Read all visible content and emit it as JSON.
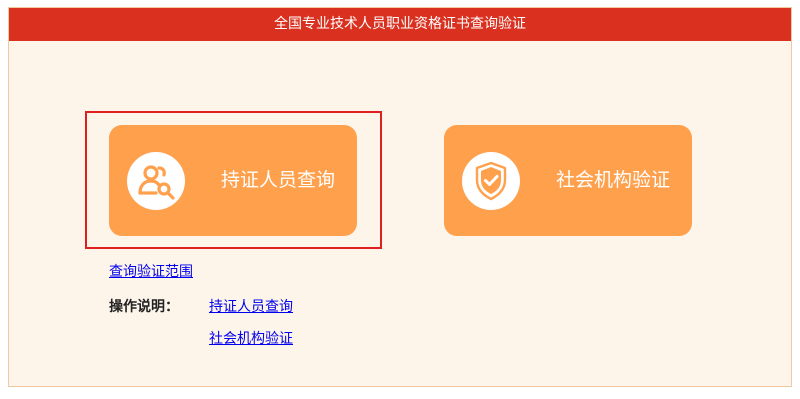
{
  "header": {
    "title": "全国专业技术人员职业资格证书查询验证"
  },
  "tiles": [
    {
      "label": "持证人员查询",
      "icon": "person-search-icon"
    },
    {
      "label": "社会机构验证",
      "icon": "shield-check-icon"
    }
  ],
  "links": {
    "scope": "查询验证范围",
    "instructions_label": "操作说明：",
    "instruction_person": "持证人员查询",
    "instruction_org": "社会机构验证"
  },
  "colors": {
    "header": "#d9301f",
    "tile": "#ffa04d",
    "page_background": "#fdf4ea",
    "highlight_border": "#e02020",
    "link": "#0000ee"
  }
}
